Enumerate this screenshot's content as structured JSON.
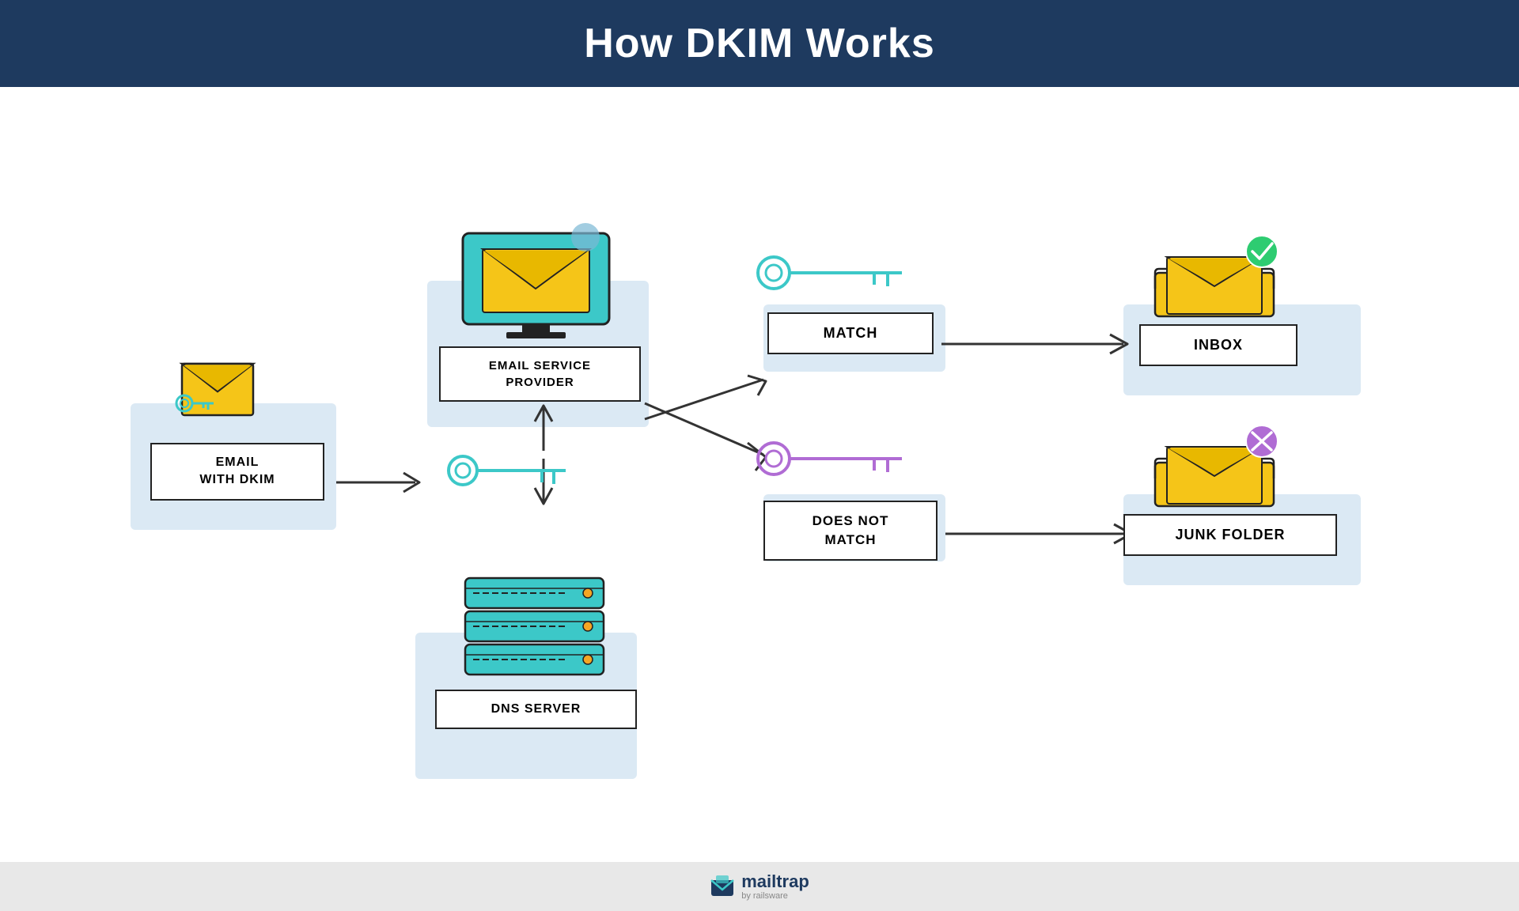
{
  "header": {
    "title": "How DKIM Works"
  },
  "diagram": {
    "email_label": "EMAIL\nWITH DKIM",
    "esp_label": "EMAIL SERVICE\nPROVIDER",
    "dns_label": "DNS SERVER",
    "match_label": "MATCH",
    "no_match_label": "DOES NOT\nMATCH",
    "inbox_label": "INBOX",
    "junk_label": "JUNK FOLDER"
  },
  "footer": {
    "brand": "mailtrap",
    "sub": "by railsware"
  },
  "colors": {
    "header_bg": "#1e3a5f",
    "teal": "#3cc8c8",
    "yellow": "#f5c518",
    "purple": "#b06cd4",
    "green_check": "#2ecc71",
    "red_x": "#e74c3c",
    "blue_rect": "#b8d4ea",
    "key_teal": "#3cc8c8",
    "key_purple": "#b06cd4"
  }
}
